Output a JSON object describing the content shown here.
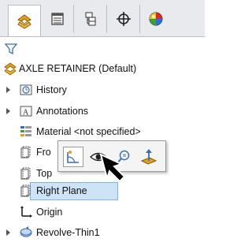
{
  "tabs": [
    {
      "name": "featuremanager-icon"
    },
    {
      "name": "propertymanager-icon"
    },
    {
      "name": "configurationmanager-icon"
    },
    {
      "name": "dimxpertmanager-icon"
    },
    {
      "name": "displaymanager-icon"
    }
  ],
  "tree": {
    "root_label": "AXLE RETAINER  (Default)",
    "items": [
      {
        "label": "History"
      },
      {
        "label": "Annotations"
      },
      {
        "label": "Material <not specified>"
      },
      {
        "label": "Fro"
      },
      {
        "label": "Top"
      },
      {
        "label": "Right Plane"
      },
      {
        "label": "Origin"
      },
      {
        "label": "Revolve-Thin1"
      }
    ]
  },
  "context_toolbar": {
    "buttons": [
      "sketch-icon",
      "show-hide-eye-icon",
      "zoom-to-selection-icon",
      "normal-to-icon"
    ]
  },
  "colors": {
    "accent_orange": "#e2a020",
    "selection_fill": "#cfe3f7",
    "selection_border": "#7fb2e5"
  }
}
